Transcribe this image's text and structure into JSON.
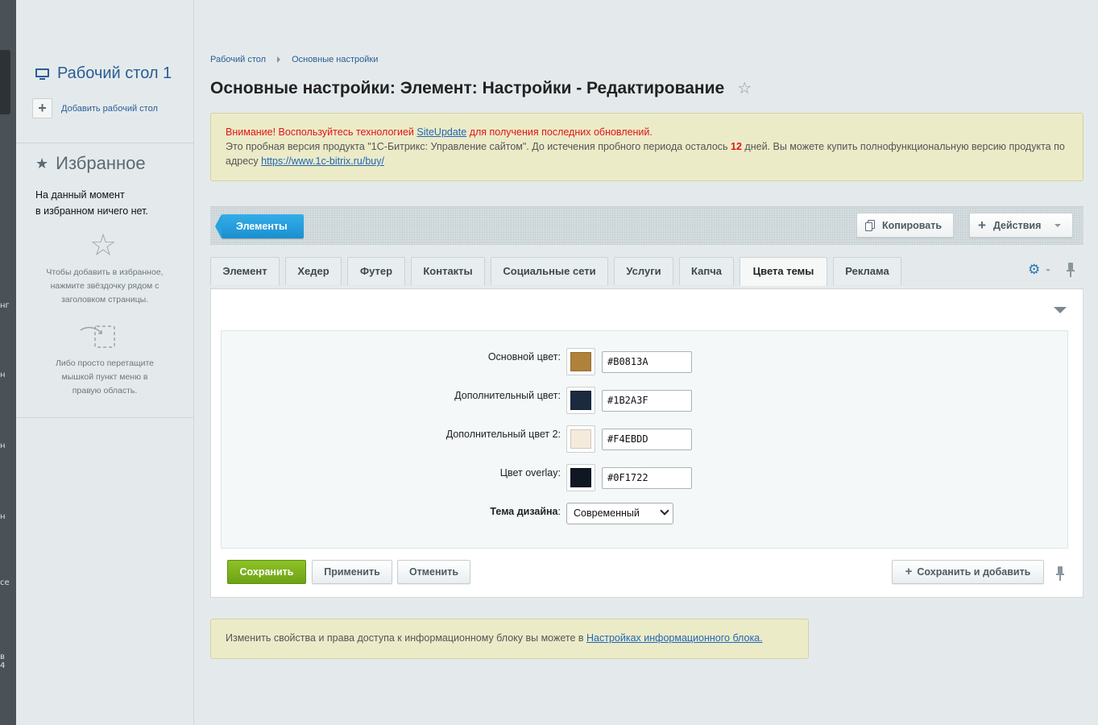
{
  "sidebar": {
    "desktop_title": "Рабочий стол 1",
    "add_desktop": "Добавить рабочий стол",
    "favorites_title": "Избранное",
    "favorites_empty_line1": "На данный момент",
    "favorites_empty_line2": "в избранном ничего нет.",
    "hint_star_1": "Чтобы добавить в избранное,",
    "hint_star_2": "нажмите звёздочку рядом с",
    "hint_star_3": "заголовком страницы.",
    "hint_drag_1": "Либо просто перетащите",
    "hint_drag_2": "мышкой пункт меню в",
    "hint_drag_3": "правую область.",
    "strip_fragments": [
      "нг",
      "н",
      "н",
      "н",
      "се",
      "в",
      "4"
    ]
  },
  "breadcrumb": {
    "items": [
      "Рабочий стол",
      "Основные настройки"
    ]
  },
  "page": {
    "title": "Основные настройки: Элемент: Настройки - Редактирование"
  },
  "notice": {
    "warn_prefix": "Внимание! Воспользуйтесь технологией ",
    "warn_link": "SiteUpdate",
    "warn_suffix": " для получения последних обновлений.",
    "trial_prefix": "Это пробная версия продукта \"1С-Битрикс: Управление сайтом\". До истечения пробного периода осталось ",
    "trial_days": "12",
    "trial_suffix": " дней. Вы можете купить полнофункциональную версию продукта по адресу ",
    "trial_link": "https://www.1c-bitrix.ru/buy/"
  },
  "toolbar": {
    "elements_label": "Элементы",
    "copy_label": "Копировать",
    "actions_label": "Действия"
  },
  "tabs": [
    {
      "label": "Элемент"
    },
    {
      "label": "Хедер"
    },
    {
      "label": "Футер"
    },
    {
      "label": "Контакты"
    },
    {
      "label": "Социальные сети"
    },
    {
      "label": "Услуги"
    },
    {
      "label": "Капча"
    },
    {
      "label": "Цвета темы",
      "active": true
    },
    {
      "label": "Реклама"
    }
  ],
  "form": {
    "fields": [
      {
        "label": "Основной цвет:",
        "value": "#B0813A",
        "color": "#B0813A"
      },
      {
        "label": "Дополнительный цвет:",
        "value": "#1B2A3F",
        "color": "#1B2A3F"
      },
      {
        "label": "Дополнительный цвет 2:",
        "value": "#F4EBDD",
        "color": "#F4EBDD"
      },
      {
        "label": "Цвет overlay:",
        "value": "#0F1722",
        "color": "#0F1722"
      }
    ],
    "theme_label": "Тема дизайна",
    "theme_colon": ":",
    "theme_value": "Современный"
  },
  "buttons": {
    "save": "Сохранить",
    "apply": "Применить",
    "cancel": "Отменить",
    "save_add": "Сохранить и добавить"
  },
  "info": {
    "text": "Изменить свойства и права доступа к информационному блоку вы можете в ",
    "link": "Настройках информационного блока."
  },
  "colors": {
    "accent": "#2a5c96",
    "save_green": "#7bb11c",
    "elements_blue": "#24a0e0",
    "notice_bg": "#ecebc8",
    "warn_red": "#e01515"
  }
}
